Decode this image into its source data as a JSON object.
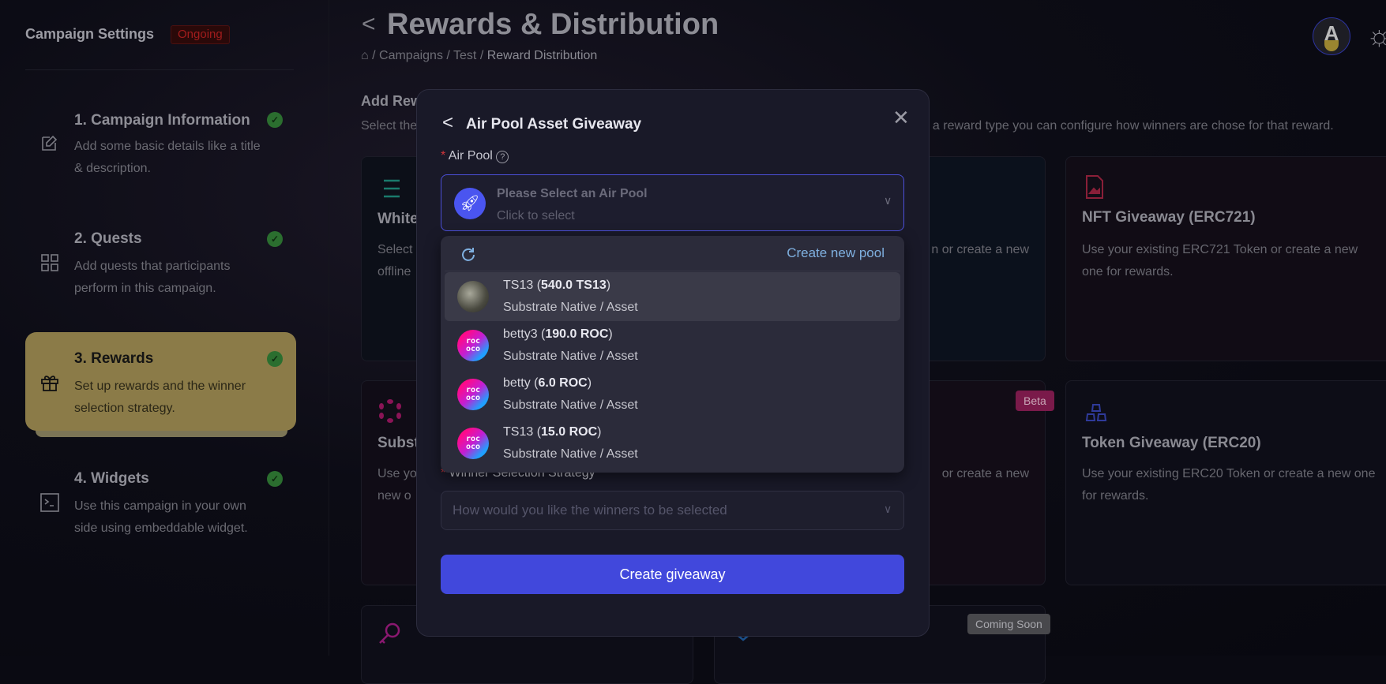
{
  "sidebar": {
    "title": "Campaign Settings",
    "status_badge": "Ongoing",
    "steps": [
      {
        "title": "1. Campaign Information",
        "desc": "Add some basic details like a title & description.",
        "icon": "edit-icon",
        "done": true
      },
      {
        "title": "2. Quests",
        "desc": "Add quests that participants perform in this campaign.",
        "icon": "grid-icon",
        "done": true
      },
      {
        "title": "3. Rewards",
        "desc": "Set up rewards and the winner selection strategy.",
        "icon": "gift-icon",
        "done": true,
        "active": true
      },
      {
        "title": "4. Widgets",
        "desc": "Use this campaign in your own side using embeddable widget.",
        "icon": "terminal-icon",
        "done": true
      }
    ]
  },
  "header": {
    "title": "Rewards & Distribution",
    "breadcrumb": [
      "Campaigns",
      "Test",
      "Reward Distribution"
    ]
  },
  "section": {
    "title": "Add Rew",
    "subtitle_left": "Select the",
    "subtitle_right": "t a reward type you can configure how winners are chose for that reward."
  },
  "cards": {
    "whitelist": {
      "title": "White",
      "desc1": "Select",
      "desc2": "offline"
    },
    "middle_top": {
      "desc_fragment": "n or create a new"
    },
    "nft": {
      "title": "NFT Giveaway (ERC721)",
      "desc": "Use your existing ERC721 Token or create a new one for rewards."
    },
    "substrate": {
      "title": "Subst",
      "desc1": "Use yo",
      "desc2": "new o"
    },
    "middle_mid": {
      "badge": "Beta",
      "desc_fragment": "or create a new"
    },
    "token": {
      "title": "Token Giveaway (ERC20)",
      "desc": "Use your existing ERC20 Token or create a new one for rewards."
    },
    "bottom_mid": {
      "badge": "Coming Soon"
    }
  },
  "modal": {
    "title": "Air Pool Asset Giveaway",
    "air_pool_label": "Air Pool",
    "select_placeholder": "Please Select an Air Pool",
    "select_hint": "Click to select",
    "create_pool": "Create new pool",
    "pools": [
      {
        "name": "TS13",
        "amount": "540.0 TS13",
        "type": "Substrate Native / Asset",
        "avatar": "photo"
      },
      {
        "name": "betty3",
        "amount": "190.0 ROC",
        "type": "Substrate Native / Asset",
        "avatar": "rococo"
      },
      {
        "name": "betty",
        "amount": "6.0 ROC",
        "type": "Substrate Native / Asset",
        "avatar": "rococo"
      },
      {
        "name": "TS13",
        "amount": "15.0 ROC",
        "type": "Substrate Native / Asset",
        "avatar": "rococo"
      }
    ],
    "strategy_label": "Winner Selection Strategy",
    "strategy_placeholder": "How would you like the winners to be selected",
    "submit": "Create giveaway"
  },
  "colors": {
    "accent": "#4148dc",
    "active_step": "#8b7b48",
    "link": "#7fb0e0",
    "check": "#2b6e2f"
  }
}
